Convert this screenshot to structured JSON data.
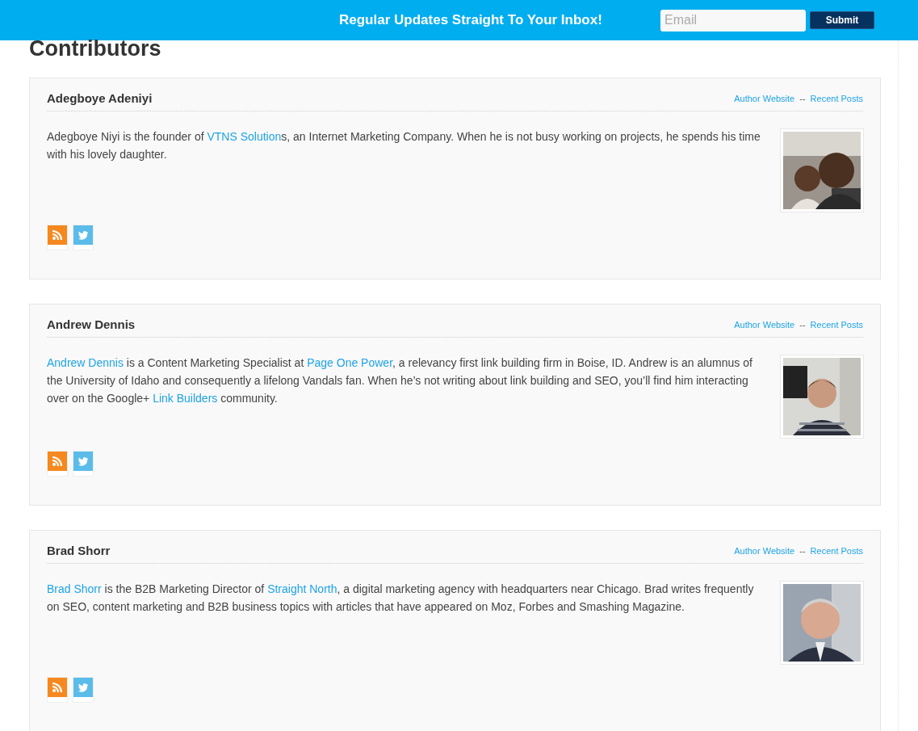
{
  "signup_bar": {
    "headline": "Regular Updates Straight To Your Inbox!",
    "email": {
      "placeholder": "Email"
    },
    "submit": "Submit"
  },
  "page_title": "Contributors",
  "contributors": [
    {
      "name": "Adegboye Adeniyi",
      "author_website": "Author Website",
      "separator": "--",
      "recent_posts": "Recent Posts",
      "bio": [
        {
          "text": "Adegboye Niyi is the founder of ",
          "kind": "text"
        },
        {
          "text": "VTNS Solution",
          "kind": "link"
        },
        {
          "text": "s, an Internet Marketing Company. When he is not busy working on projects, he spends his time with his lovely daughter.",
          "kind": "text"
        }
      ],
      "photo": {
        "kind": "picture"
      }
    },
    {
      "name": "Andrew Dennis",
      "author_website": "Author Website",
      "separator": "--",
      "recent_posts": "Recent Posts",
      "bio": [
        {
          "text": "Andrew Dennis",
          "kind": "link"
        },
        {
          "text": " is a Content Marketing Specialist at ",
          "kind": "text"
        },
        {
          "text": "Page One Power",
          "kind": "link"
        },
        {
          "text": ", a relevancy first link building firm in Boise, ID. Andrew is an alumnus of the University of Idaho and consequently a lifelong Vandals fan. When he’s not writing about link building and SEO, you’ll find him interacting over on the Google+ ",
          "kind": "text"
        },
        {
          "text": "Link Builders",
          "kind": "link"
        },
        {
          "text": " community.",
          "kind": "text"
        }
      ],
      "photo": {
        "kind": "picture"
      }
    },
    {
      "name": "Brad Shorr",
      "author_website": "Author Website",
      "separator": "--",
      "recent_posts": "Recent Posts",
      "bio": [
        {
          "text": "Brad Shorr",
          "kind": "link"
        },
        {
          "text": " is the B2B Marketing Director of ",
          "kind": "text"
        },
        {
          "text": "Straight North",
          "kind": "link"
        },
        {
          "text": ", a digital marketing agency with headquarters near Chicago. Brad writes frequently on SEO, content marketing and B2B business topics with articles that have appeared on Moz, Forbes and Smashing Magazine.",
          "kind": "text"
        }
      ],
      "photo": {
        "kind": "picture"
      }
    }
  ]
}
